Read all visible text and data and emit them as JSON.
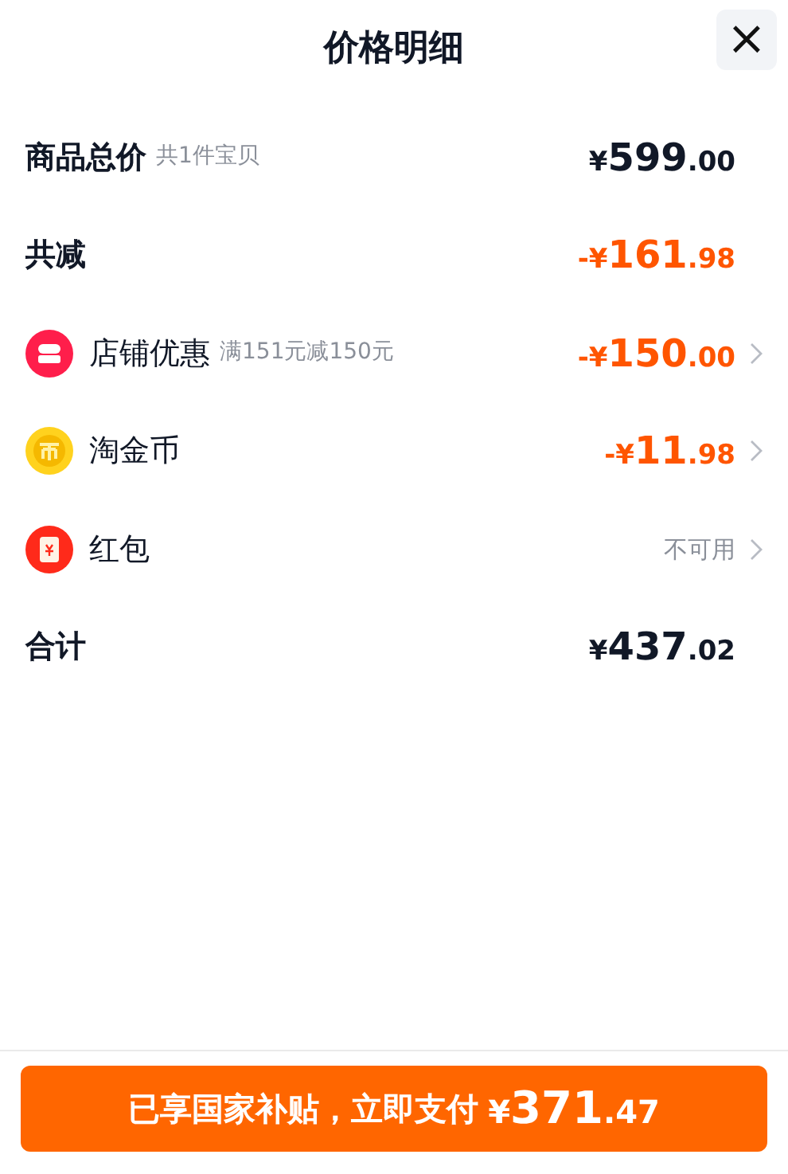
{
  "header": {
    "title": "价格明细",
    "close": "×"
  },
  "rows": [
    {
      "kind": "plain",
      "label": "商品总价",
      "note": "共1件宝贝",
      "color": "#111827",
      "price": {
        "sign": "¥",
        "int": "599",
        "dec": ".00"
      },
      "has_arrow": false
    },
    {
      "kind": "plain",
      "label": "共减",
      "color": "#ff5500",
      "price": {
        "sign": "-¥",
        "int": "161",
        "dec": ".98"
      },
      "has_arrow": false
    },
    {
      "kind": "shop",
      "label": "店铺优惠",
      "note": "满151元减150元",
      "color": "#ff5500",
      "price": {
        "sign": "-¥",
        "int": "150",
        "dec": ".00"
      },
      "has_arrow": true
    },
    {
      "kind": "coin",
      "label": "淘金币",
      "color": "#ff5500",
      "price": {
        "sign": "-¥",
        "int": "11",
        "dec": ".98"
      },
      "has_arrow": true
    },
    {
      "kind": "redpacket",
      "label": "红包",
      "color": "#8a8f99",
      "value": "不可用",
      "has_arrow": true
    },
    {
      "kind": "plain",
      "label": "合计",
      "color": "#111827",
      "price": {
        "sign": "¥",
        "int": "437",
        "dec": ".02"
      },
      "has_arrow": false
    }
  ],
  "pay_button": {
    "label": "已享国家补贴，立即支付",
    "price": {
      "sign": "¥",
      "int": "371",
      "dec": ".47"
    }
  }
}
